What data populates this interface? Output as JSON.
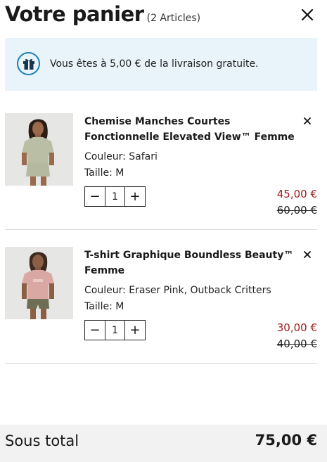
{
  "header": {
    "title": "Votre panier",
    "count": "(2 Articles)"
  },
  "banner": {
    "icon": "gift-icon",
    "text": "Vous êtes à 5,00 € de la livraison gratuite."
  },
  "items": [
    {
      "name": "Chemise Manches Courtes Fonctionnelle Elevated View™ Femme",
      "color": "Couleur: Safari",
      "size": "Taille: M",
      "quantity": "1",
      "sale_price": "45,00 €",
      "original_price": "60,00 €"
    },
    {
      "name": "T-shirt Graphique Boundless Beauty™ Femme",
      "color": "Couleur: Eraser Pink, Outback Critters",
      "size": "Taille: M",
      "quantity": "1",
      "sale_price": "30,00 €",
      "original_price": "40,00 €"
    }
  ],
  "stepper": {
    "decrement": "−",
    "increment": "+"
  },
  "footer": {
    "subtotal_label": "Sous total",
    "subtotal_value": "75,00 €"
  },
  "colors": {
    "banner_bg": "#e8f3fa",
    "accent": "#1a7fb7",
    "sale": "#a01a1a",
    "footer_bg": "#f2f2f2"
  }
}
